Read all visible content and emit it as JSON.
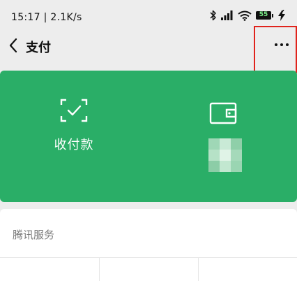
{
  "status_bar": {
    "time_speed": "15:17 | 2.1K/s",
    "battery_level": "55"
  },
  "nav": {
    "title": "支付"
  },
  "payment_card": {
    "pay_label": "收付款",
    "accent_color": "#2aae67"
  },
  "services": {
    "title": "腾讯服务"
  },
  "colors": {
    "highlight_border": "#e0231c",
    "background": "#ededed"
  },
  "icons": [
    "back-arrow-icon",
    "more-icon",
    "scan-check-icon",
    "wallet-icon",
    "bluetooth-icon",
    "signal-icon",
    "wifi-icon",
    "battery-icon",
    "charging-icon"
  ]
}
